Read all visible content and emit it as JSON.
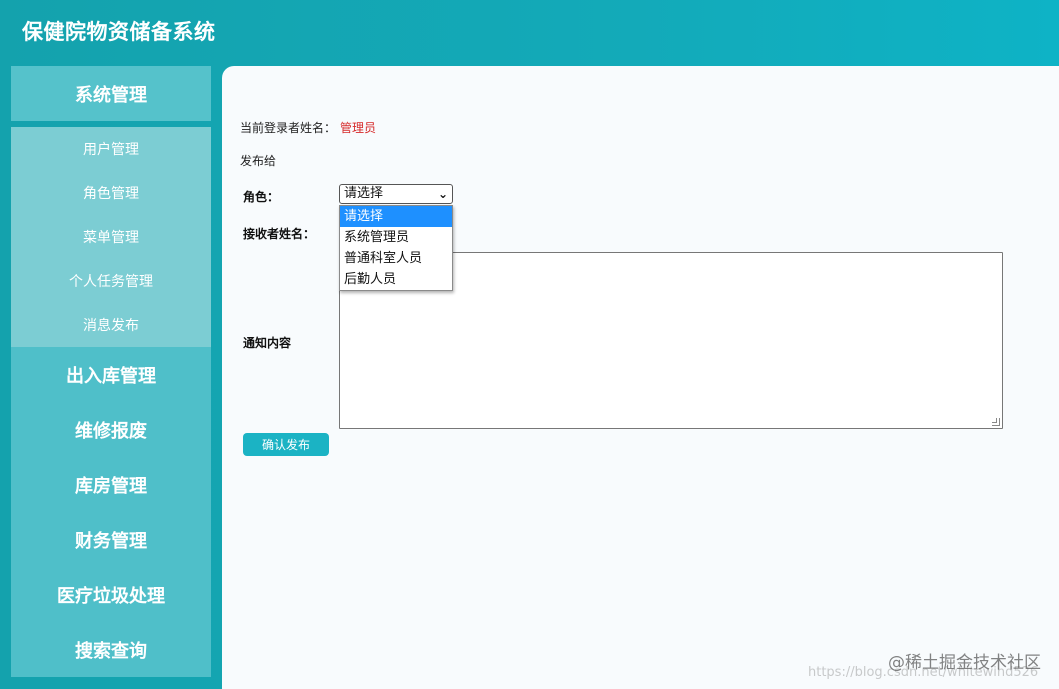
{
  "app": {
    "title": "保健院物资储备系统"
  },
  "sidebar": {
    "system_group": "系统管理",
    "system_items": [
      "用户管理",
      "角色管理",
      "菜单管理",
      "个人任务管理",
      "消息发布"
    ],
    "groups": [
      "出入库管理",
      "维修报废",
      "库房管理",
      "财务管理",
      "医疗垃圾处理",
      "搜索查询"
    ]
  },
  "form": {
    "login_label": "当前登录者姓名：",
    "login_name": "管理员",
    "publish_to": "发布给",
    "role_label": "角色：",
    "receiver_label": "接收者姓名：",
    "notice_label": "通知内容",
    "role_selected": "请选择",
    "role_options": [
      "请选择",
      "系统管理员",
      "普通科室人员",
      "后勤人员"
    ],
    "submit": "确认发布"
  },
  "watermark": {
    "main": "@稀土掘金技术社区",
    "faint": "https://blog.csdn.net/whitewind526"
  },
  "colors": {
    "accent": "#13aab9",
    "dropdown_selected": "#1e90ff",
    "login_name": "#d62a2a"
  }
}
